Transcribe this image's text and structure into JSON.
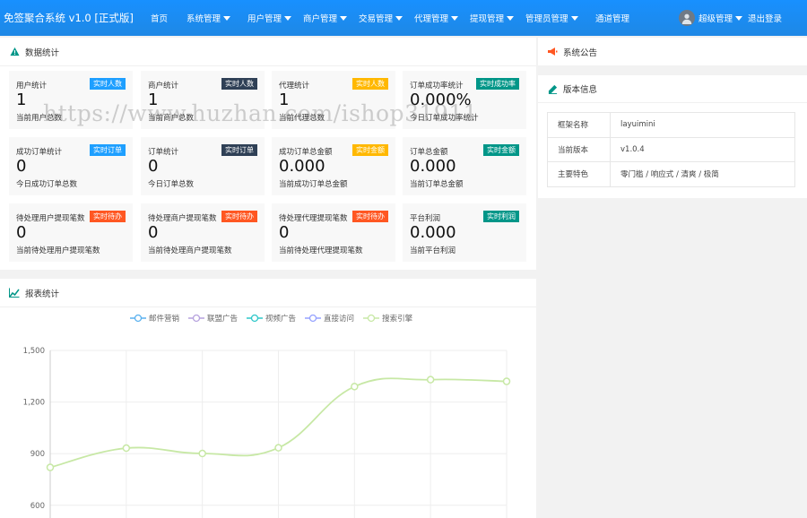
{
  "header": {
    "brand": "免签聚合系统 v1.0 [正式版]",
    "nav": [
      {
        "label": "首页",
        "dropdown": false
      },
      {
        "label": "系统管理",
        "dropdown": true
      },
      {
        "label": "用户管理",
        "dropdown": true
      },
      {
        "label": "商户管理",
        "dropdown": true
      },
      {
        "label": "交易管理",
        "dropdown": true
      },
      {
        "label": "代理管理",
        "dropdown": true
      },
      {
        "label": "提现管理",
        "dropdown": true
      },
      {
        "label": "管理员管理",
        "dropdown": true
      },
      {
        "label": "通道管理",
        "dropdown": false
      }
    ],
    "user_label": "超级管理",
    "logout": "退出登录"
  },
  "stats_panel": {
    "title": "数据统计",
    "cards": [
      {
        "title": "用户统计",
        "badge": "实时人数",
        "badge_color": "#1e9fff",
        "value": "1",
        "desc": "当前用户总数"
      },
      {
        "title": "商户统计",
        "badge": "实时人数",
        "badge_color": "#2f4056",
        "value": "1",
        "desc": "当前商户总数"
      },
      {
        "title": "代理统计",
        "badge": "实时人数",
        "badge_color": "#ffb800",
        "value": "1",
        "desc": "当前代理总数"
      },
      {
        "title": "订单成功率统计",
        "badge": "实时成功率",
        "badge_color": "#009688",
        "value": "0.000%",
        "desc": "今日订单成功率统计"
      },
      {
        "title": "成功订单统计",
        "badge": "实时订单",
        "badge_color": "#1e9fff",
        "value": "0",
        "desc": "今日成功订单总数"
      },
      {
        "title": "订单统计",
        "badge": "实时订单",
        "badge_color": "#2f4056",
        "value": "0",
        "desc": "今日订单总数"
      },
      {
        "title": "成功订单总金额",
        "badge": "实时金额",
        "badge_color": "#ffb800",
        "value": "0.000",
        "desc": "当前成功订单总金额"
      },
      {
        "title": "订单总金额",
        "badge": "实时金额",
        "badge_color": "#009688",
        "value": "0.000",
        "desc": "当前订单总金额"
      },
      {
        "title": "待处理用户提现笔数",
        "badge": "实时待办",
        "badge_color": "#ff5722",
        "value": "0",
        "desc": "当前待处理用户提现笔数"
      },
      {
        "title": "待处理商户提现笔数",
        "badge": "实时待办",
        "badge_color": "#ff5722",
        "value": "0",
        "desc": "当前待处理商户提现笔数"
      },
      {
        "title": "待处理代理提现笔数",
        "badge": "实时待办",
        "badge_color": "#ff5722",
        "value": "0",
        "desc": "当前待处理代理提现笔数"
      },
      {
        "title": "平台利润",
        "badge": "实时利润",
        "badge_color": "#009688",
        "value": "0.000",
        "desc": "当前平台利润"
      }
    ]
  },
  "announcement": {
    "title": "系统公告"
  },
  "version": {
    "title": "版本信息",
    "rows": [
      {
        "key": "框架名称",
        "value": "layuimini"
      },
      {
        "key": "当前版本",
        "value": "v1.0.4"
      },
      {
        "key": "主要特色",
        "value": "零门槛 / 响应式 / 清爽 / 极简"
      }
    ]
  },
  "report": {
    "title": "报表统计"
  },
  "watermark": "https://www.huzhan.com/ishop31911",
  "chart_data": {
    "type": "line",
    "legend": [
      "邮件营销",
      "联盟广告",
      "视频广告",
      "直接访问",
      "搜索引擎"
    ],
    "legend_colors": [
      "#5ab1ef",
      "#b6a2de",
      "#2ec7c9",
      "#95a2ff",
      "#c7e8a5"
    ],
    "y_ticks": [
      "1,500",
      "1,200",
      "900",
      "600"
    ],
    "ylim": [
      600,
      1500
    ],
    "visible_series": {
      "name": "搜索引擎",
      "color": "#c7e8a5",
      "values": [
        820,
        932,
        901,
        934,
        1290,
        1330,
        1320
      ]
    }
  }
}
